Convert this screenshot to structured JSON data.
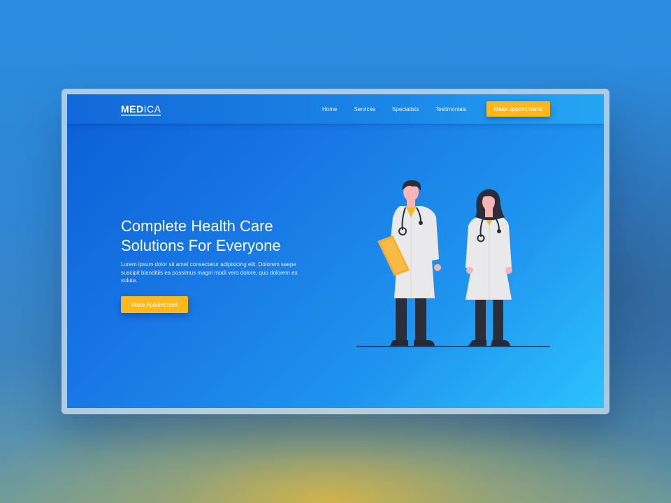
{
  "brand": {
    "logo_bold": "MED",
    "logo_light": "ICA"
  },
  "nav": {
    "links": [
      "Home",
      "Services",
      "Specialists",
      "Testimonials"
    ],
    "cta_label": "Make appointments"
  },
  "hero": {
    "title": "Complete Health Care\nSolutions For Everyone",
    "description": "Lorem ipsum dolor sit amet consectetur adipisicing elit. Dolorem saepe suscipit blanditiis ea possimus magni modi vero dolore, quo dolorem ex soluta.",
    "cta_label": "Make Appointment"
  },
  "colors": {
    "accent": "#ffb81c",
    "primary_blue": "#1876e4",
    "light_blue": "#2cc2fc",
    "coat": "#e8e8ea",
    "trousers": "#2a2d3a"
  },
  "illustration": {
    "subject": "two doctors in white coats with stethoscopes"
  }
}
